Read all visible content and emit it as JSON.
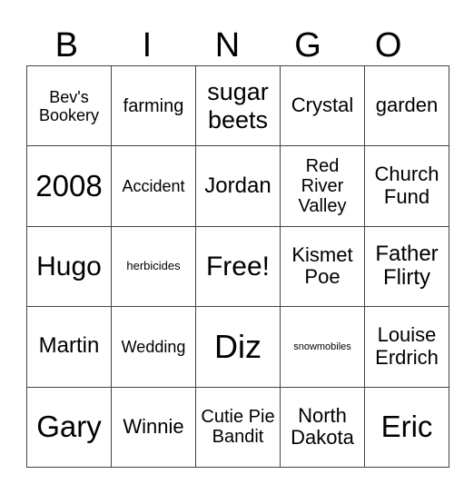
{
  "header": {
    "letters": [
      "B",
      "I",
      "N",
      "G",
      "O"
    ]
  },
  "cells": [
    [
      "Bev's Bookery",
      "farming",
      "sugar beets",
      "Crystal",
      "garden"
    ],
    [
      "2008",
      "Accident",
      "Jordan",
      "Red River Valley",
      "Church Fund"
    ],
    [
      "Hugo",
      "herbicides",
      "Free!",
      "Kismet Poe",
      "Father Flirty"
    ],
    [
      "Martin",
      "Wedding",
      "Diz",
      "snowmobiles",
      "Louise Erdrich"
    ],
    [
      "Gary",
      "Winnie",
      "Cutie Pie Bandit",
      "North Dakota",
      "Eric"
    ]
  ]
}
